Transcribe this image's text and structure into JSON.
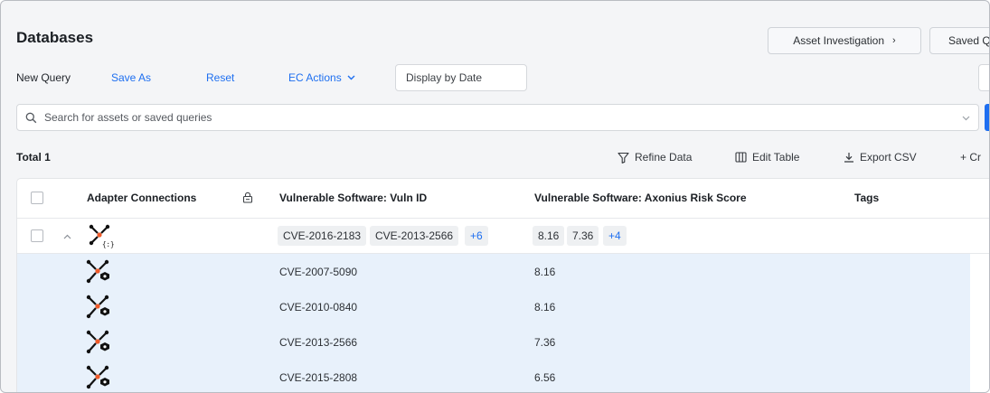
{
  "page": {
    "title": "Databases"
  },
  "header_buttons": {
    "asset_investigation": "Asset Investigation",
    "saved_queries": "Saved Q"
  },
  "toolbar": {
    "new_query": "New Query",
    "save_as": "Save As",
    "reset": "Reset",
    "ec_actions": "EC Actions",
    "display_by_date": "Display by Date"
  },
  "search": {
    "placeholder": "Search for assets or saved queries"
  },
  "results": {
    "total_label": "Total 1"
  },
  "table_actions": {
    "refine": "Refine Data",
    "edit": "Edit Table",
    "export": "Export CSV",
    "create": "+ Cr"
  },
  "columns": {
    "adapter": "Adapter Connections",
    "vuln_id": "Vulnerable Software: Vuln ID",
    "risk": "Vulnerable Software: Axonius Risk Score",
    "tags": "Tags"
  },
  "main_row": {
    "ids": [
      "CVE-2016-2183",
      "CVE-2013-2566"
    ],
    "ids_more": "+6",
    "scores": [
      "8.16",
      "7.36"
    ],
    "scores_more": "+4"
  },
  "sub_rows": [
    {
      "id": "CVE-2007-5090",
      "score": "8.16"
    },
    {
      "id": "CVE-2010-0840",
      "score": "8.16"
    },
    {
      "id": "CVE-2013-2566",
      "score": "7.36"
    },
    {
      "id": "CVE-2015-2808",
      "score": "6.56"
    }
  ],
  "icons": {
    "search": "search-icon",
    "chevron_down": "chevron-down-icon",
    "chevron_right": "chevron-right-icon",
    "lock": "lock-icon",
    "filter": "filter-icon",
    "columns": "columns-icon",
    "download": "download-icon",
    "collapse": "chevron-up-icon",
    "adapter": "adapter-icon"
  },
  "colors": {
    "accent": "#1e6ff0",
    "row_highlight": "#e8f1fb",
    "adapter_orange": "#f05a28"
  }
}
